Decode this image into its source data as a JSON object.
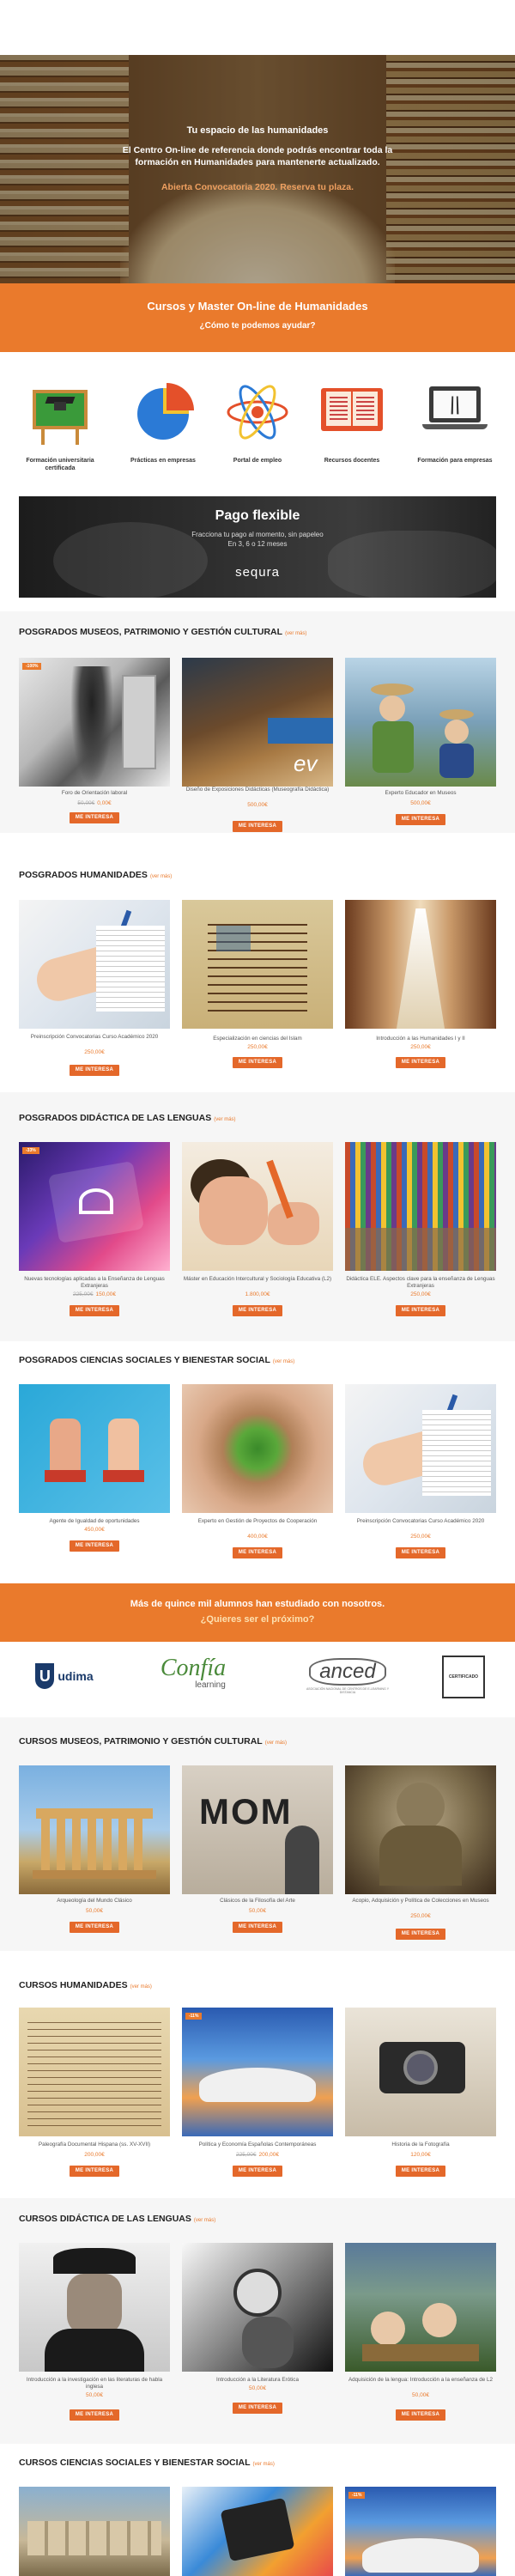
{
  "hero": {
    "line1": "Tu espacio de las humanidades",
    "line2": "El Centro On-line de referencia donde podrás encontrar toda la formación en Humanidades para mantenerte actualizado.",
    "line3": "Abierta Convocatoria 2020. Reserva tu plaza."
  },
  "banner": {
    "title": "Cursos y Master On-line de Humanidades",
    "subtitle": "¿Cómo te podemos ayudar?"
  },
  "features": [
    {
      "label": "Formación universitaria certificada",
      "icon": "graduation-board-icon"
    },
    {
      "label": "Prácticas en empresas",
      "icon": "pie-chart-icon"
    },
    {
      "label": "Portal de empleo",
      "icon": "atom-icon"
    },
    {
      "label": "Recursos docentes",
      "icon": "open-book-icon"
    },
    {
      "label": "Formación para empresas",
      "icon": "laptop-icon"
    }
  ],
  "pago": {
    "title": "Pago flexible",
    "line1": "Fracciona tu pago al momento, sin papeleo",
    "line2": "En 3, 6 o 12 meses",
    "brand": "sequra"
  },
  "common": {
    "more": "(ver más)",
    "button": "ME INTERESA"
  },
  "sections": [
    {
      "title": "POSGRADOS MUSEOS, PATRIMONIO Y GESTIÓN CULTURAL",
      "items": [
        {
          "caption": "Foro de Orientación laboral",
          "old": "50,00€",
          "price": "0,00€",
          "badge": "-100%"
        },
        {
          "caption": "Diseño de Exposiciones Didácticas (Museografía Didáctica)",
          "old": "",
          "price": "500,00€",
          "badge": ""
        },
        {
          "caption": "Experto Educador en Museos",
          "old": "",
          "price": "500,00€",
          "badge": ""
        }
      ]
    },
    {
      "title": "POSGRADOS HUMANIDADES",
      "items": [
        {
          "caption": "Preinscripción Convocatorias Curso Académico 2020",
          "old": "",
          "price": "250,00€",
          "badge": ""
        },
        {
          "caption": "Especialización en ciencias del Islam",
          "old": "",
          "price": "250,00€",
          "badge": ""
        },
        {
          "caption": "Introducción a las Humanidades I y II",
          "old": "",
          "price": "250,00€",
          "badge": ""
        }
      ]
    },
    {
      "title": "POSGRADOS DIDÁCTICA DE LAS LENGUAS",
      "items": [
        {
          "caption": "Nuevas tecnologías aplicadas a la Enseñanza de Lenguas Extranjeras",
          "old": "225,00€",
          "price": "150,00€",
          "badge": "-33%"
        },
        {
          "caption": "Máster en Educación Intercultural y Sociología Educativa (L2)",
          "old": "",
          "price": "1.800,00€",
          "badge": ""
        },
        {
          "caption": "Didáctica ELE. Aspectos clave para la enseñanza de Lenguas Extranjeras",
          "old": "",
          "price": "250,00€",
          "badge": ""
        }
      ]
    },
    {
      "title": "POSGRADOS CIENCIAS SOCIALES Y BIENESTAR SOCIAL",
      "items": [
        {
          "caption": "Agente de Igualdad de oportunidades",
          "old": "",
          "price": "450,00€",
          "badge": ""
        },
        {
          "caption": "Experto en Gestión de Proyectos de Cooperación",
          "old": "",
          "price": "400,00€",
          "badge": ""
        },
        {
          "caption": "Preinscripción Convocatorias Curso Académico 2020",
          "old": "",
          "price": "250,00€",
          "badge": ""
        }
      ]
    },
    {
      "title": "CURSOS MUSEOS, PATRIMONIO Y GESTIÓN CULTURAL",
      "items": [
        {
          "caption": "Arqueología del Mundo Clásico",
          "old": "",
          "price": "50,00€",
          "badge": ""
        },
        {
          "caption": "Clásicos de la Filosofía del Arte",
          "old": "",
          "price": "50,00€",
          "badge": ""
        },
        {
          "caption": "Acopio, Adquisición y Política de Colecciones en Museos",
          "old": "",
          "price": "250,00€",
          "badge": ""
        }
      ]
    },
    {
      "title": "CURSOS HUMANIDADES",
      "items": [
        {
          "caption": "Paleografía Documental Hispana (ss. XV-XVII)",
          "old": "",
          "price": "200,00€",
          "badge": ""
        },
        {
          "caption": "Política y Economía Españolas Contemporáneas",
          "old": "225,00€",
          "price": "200,00€",
          "badge": "-11%"
        },
        {
          "caption": "Historia de la Fotografía",
          "old": "",
          "price": "120,00€",
          "badge": ""
        }
      ]
    },
    {
      "title": "CURSOS DIDÁCTICA DE LAS LENGUAS",
      "items": [
        {
          "caption": "Introducción a la investigación en las literaturas de habla inglesa",
          "old": "",
          "price": "50,00€",
          "badge": ""
        },
        {
          "caption": "Introducción a la Literatura Erótica",
          "old": "",
          "price": "50,00€",
          "badge": ""
        },
        {
          "caption": "Adquisición de la lengua: Introducción a la enseñanza de L2",
          "old": "",
          "price": "50,00€",
          "badge": ""
        }
      ]
    },
    {
      "title": "CURSOS CIENCIAS SOCIALES Y BIENESTAR SOCIAL",
      "items": [
        {
          "caption": "",
          "old": "",
          "price": "",
          "badge": ""
        },
        {
          "caption": "",
          "old": "",
          "price": "",
          "badge": ""
        },
        {
          "caption": "",
          "old": "",
          "price": "",
          "badge": "-11%"
        }
      ]
    }
  ],
  "students": {
    "line1": "Más de quince mil alumnos han estudiado con nosotros.",
    "line2": "¿Quieres ser el próximo?"
  },
  "logos": {
    "udima": "udima",
    "confia1": "Confía",
    "confia2": "learning",
    "anced": "anced",
    "anced_sub": "ASOCIACIÓN NACIONAL DE CENTROS DE E-LEARNING Y DISTANCIA",
    "cert": "CERTIFICADO"
  }
}
